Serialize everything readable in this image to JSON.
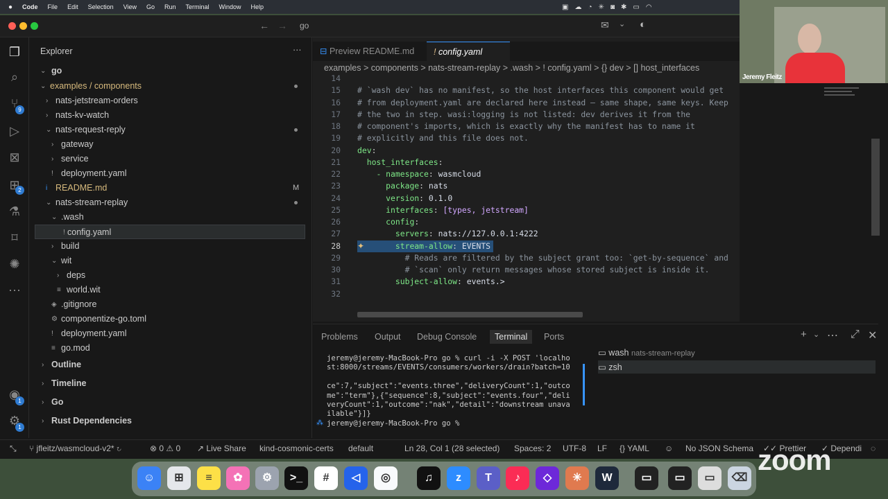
{
  "menubar": {
    "app": "Code",
    "items": [
      "File",
      "Edit",
      "Selection",
      "View",
      "Go",
      "Run",
      "Terminal",
      "Window",
      "Help"
    ]
  },
  "titlebar": {
    "search": "go"
  },
  "explorer": {
    "title": "Explorer",
    "root": "go",
    "rows": [
      {
        "label": "examples / components",
        "indent": 1,
        "chev": "open",
        "dot": true,
        "color": "#d7ba7d"
      },
      {
        "label": "nats-jetstream-orders",
        "indent": 2,
        "chev": "closed"
      },
      {
        "label": "nats-kv-watch",
        "indent": 2,
        "chev": "closed"
      },
      {
        "label": "nats-request-reply",
        "indent": 2,
        "chev": "open",
        "dot": true
      },
      {
        "label": "gateway",
        "indent": 3,
        "chev": "closed"
      },
      {
        "label": "service",
        "indent": 3,
        "chev": "closed"
      },
      {
        "label": "deployment.yaml",
        "indent": 3,
        "icon": "!"
      },
      {
        "label": "README.md",
        "indent": 2,
        "icon": "i",
        "mark": "M",
        "color": "#d7ba7d"
      },
      {
        "label": "nats-stream-replay",
        "indent": 2,
        "chev": "open",
        "dot": true
      },
      {
        "label": ".wash",
        "indent": 3,
        "chev": "open"
      },
      {
        "label": "config.yaml",
        "indent": 4,
        "icon": "!",
        "selected": true
      },
      {
        "label": "build",
        "indent": 3,
        "chev": "closed"
      },
      {
        "label": "wit",
        "indent": 3,
        "chev": "open"
      },
      {
        "label": "deps",
        "indent": 4,
        "chev": "closed"
      },
      {
        "label": "world.wit",
        "indent": 4,
        "icon": "≡"
      },
      {
        "label": ".gitignore",
        "indent": 3,
        "icon": "◈"
      },
      {
        "label": "componentize-go.toml",
        "indent": 3,
        "icon": "⚙"
      },
      {
        "label": "deployment.yaml",
        "indent": 3,
        "icon": "!"
      },
      {
        "label": "go.mod",
        "indent": 3,
        "icon": "≡"
      }
    ],
    "sections": [
      "Outline",
      "Timeline",
      "Go",
      "Rust Dependencies"
    ]
  },
  "tabs": [
    {
      "label": "Preview README.md",
      "active": false
    },
    {
      "label": "config.yaml",
      "active": true
    }
  ],
  "breadcrumb": "examples > components > nats-stream-replay > .wash > ! config.yaml > {} dev > [] host_interfaces",
  "code": [
    {
      "n": "14",
      "t": ""
    },
    {
      "n": "15",
      "t": "# `wash dev` has no manifest, so the host interfaces this component would get",
      "c": "cm"
    },
    {
      "n": "16",
      "t": "# from deployment.yaml are declared here instead — same shape, same keys. Keep",
      "c": "cm"
    },
    {
      "n": "17",
      "t": "# the two in step. wasi:logging is not listed: dev derives it from the",
      "c": "cm"
    },
    {
      "n": "18",
      "t": "# component's imports, which is exactly why the manifest has to name it",
      "c": "cm"
    },
    {
      "n": "19",
      "t": "# explicitly and this file does not.",
      "c": "cm"
    },
    {
      "n": "20",
      "k": "dev",
      "v": "",
      "ind": 0
    },
    {
      "n": "21",
      "k": "host_interfaces",
      "v": "",
      "ind": 1
    },
    {
      "n": "22",
      "k": "- namespace",
      "v": "wasmcloud",
      "ind": 2
    },
    {
      "n": "23",
      "k": "package",
      "v": "nats",
      "ind": 3
    },
    {
      "n": "24",
      "k": "version",
      "v": "0.1.0",
      "ind": 3
    },
    {
      "n": "25",
      "k": "interfaces",
      "v": "[types, jetstream]",
      "ind": 3
    },
    {
      "n": "26",
      "k": "config",
      "v": "",
      "ind": 3
    },
    {
      "n": "27",
      "k": "servers",
      "v": "nats://127.0.0.1:4222",
      "ind": 4
    },
    {
      "n": "28",
      "k": "stream-allow",
      "v": "EVENTS",
      "ind": 4
    },
    {
      "n": "29",
      "t": "          # Reads are filtered by the subject grant too: `get-by-sequence` and",
      "c": "cm"
    },
    {
      "n": "30",
      "t": "          # `scan` only return messages whose stored subject is inside it.",
      "c": "cm"
    },
    {
      "n": "31",
      "k": "subject-allow",
      "v": "events.>",
      "ind": 4
    },
    {
      "n": "32",
      "t": ""
    }
  ],
  "panel": {
    "tabs": [
      "Problems",
      "Output",
      "Debug Console",
      "Terminal",
      "Ports"
    ],
    "active": "Terminal",
    "terminal_lines": [
      "jeremy@jeremy-MacBook-Pro go % curl -i -X POST 'localho",
      "st:8000/streams/EVENTS/consumers/workers/drain?batch=10",
      "",
      "ce\":7,\"subject\":\"events.three\",\"deliveryCount\":1,\"outco",
      "me\":\"term\"},{\"sequence\":8,\"subject\":\"events.four\",\"deli",
      "veryCount\":1,\"outcome\":\"nak\",\"detail\":\"downstream unava",
      "ilable\"}]}",
      "jeremy@jeremy-MacBook-Pro go % "
    ],
    "terminals": [
      {
        "name": "wash",
        "detail": "nats-stream-replay"
      },
      {
        "name": "zsh",
        "detail": ""
      }
    ]
  },
  "status": {
    "branch": "jfleitz/wasmcloud-v2*",
    "errors": "0",
    "warnings": "0",
    "liveshare": "Live Share",
    "kube": "kind-cosmonic-certs",
    "ns": "default",
    "position": "Ln 28, Col 1 (28 selected)",
    "spaces": "Spaces: 2",
    "encoding": "UTF-8",
    "eol": "LF",
    "lang": "YAML",
    "schema": "No JSON Schema",
    "prettier": "Prettier",
    "depend": "Dependi"
  },
  "camera": {
    "name": "Jeremy Fleitz"
  },
  "watermark": "zoom",
  "colors": {
    "accent": "#2f7bd1",
    "selection": "#264f78",
    "comment": "#8b949e",
    "key": "#7ee787"
  }
}
